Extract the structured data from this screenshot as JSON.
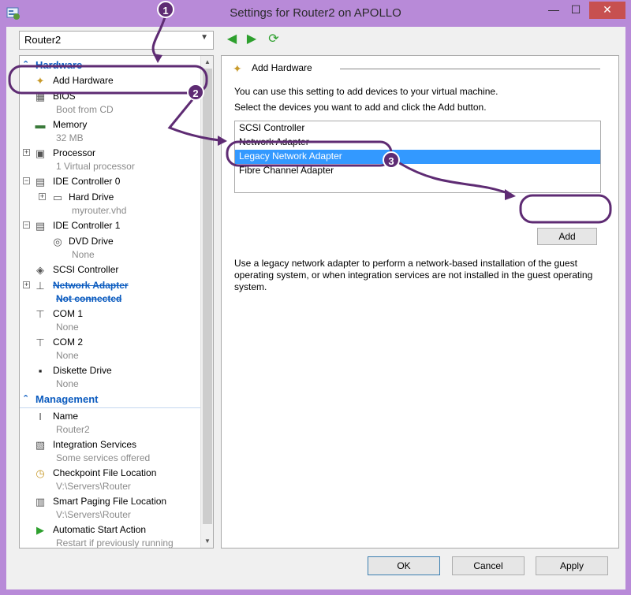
{
  "window": {
    "title": "Settings for Router2 on APOLLO",
    "minimize_glyph": "—",
    "maximize_glyph": "☐",
    "close_glyph": "✕"
  },
  "toolbar": {
    "vm_selected": "Router2",
    "back_icon": "green-left-arrow",
    "forward_icon": "green-right-arrow",
    "refresh_icon": "green-refresh"
  },
  "sidebar": {
    "hardware_header": "Hardware",
    "management_header": "Management",
    "hardware_items": [
      {
        "label": "Add Hardware",
        "sub": ""
      },
      {
        "label": "BIOS",
        "sub": "Boot from CD"
      },
      {
        "label": "Memory",
        "sub": "32 MB"
      },
      {
        "label": "Processor",
        "sub": "1 Virtual processor"
      },
      {
        "label": "IDE Controller 0",
        "sub": ""
      },
      {
        "label": "Hard Drive",
        "sub": "myrouter.vhd"
      },
      {
        "label": "IDE Controller 1",
        "sub": ""
      },
      {
        "label": "DVD Drive",
        "sub": "None"
      },
      {
        "label": "SCSI Controller",
        "sub": ""
      },
      {
        "label": "Network Adapter",
        "sub": "Not connected"
      },
      {
        "label": "COM 1",
        "sub": "None"
      },
      {
        "label": "COM 2",
        "sub": "None"
      },
      {
        "label": "Diskette Drive",
        "sub": "None"
      }
    ],
    "management_items": [
      {
        "label": "Name",
        "sub": "Router2"
      },
      {
        "label": "Integration Services",
        "sub": "Some services offered"
      },
      {
        "label": "Checkpoint File Location",
        "sub": "V:\\Servers\\Router"
      },
      {
        "label": "Smart Paging File Location",
        "sub": "V:\\Servers\\Router"
      },
      {
        "label": "Automatic Start Action",
        "sub": "Restart if previously running"
      }
    ]
  },
  "main": {
    "heading": "Add Hardware",
    "intro": "You can use this setting to add devices to your virtual machine.",
    "instruction": "Select the devices you want to add and click the Add button.",
    "devices": [
      "SCSI Controller",
      "Network Adapter",
      "Legacy Network Adapter",
      "Fibre Channel Adapter"
    ],
    "selected_device": "Legacy Network Adapter",
    "add_label": "Add",
    "description": "Use a legacy network adapter to perform a network-based installation of the guest operating system, or when integration services are not installed in the guest operating system."
  },
  "footer": {
    "ok_label": "OK",
    "cancel_label": "Cancel",
    "apply_label": "Apply"
  },
  "callouts": [
    "1",
    "2",
    "3"
  ],
  "colors": {
    "callout": "#5e2b73",
    "window_border": "#b88ad8",
    "selection": "#3399ff",
    "section_header": "#0b5bbf"
  }
}
